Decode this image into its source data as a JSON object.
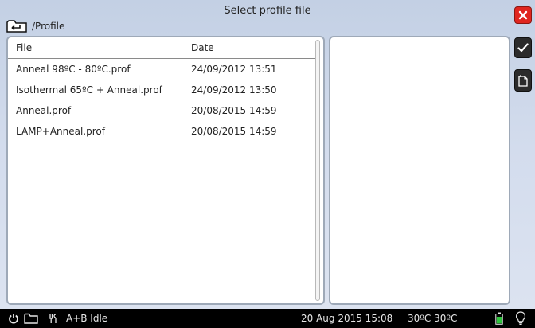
{
  "header": {
    "title": "Select profile file",
    "path": "/Profile"
  },
  "table": {
    "columns": [
      "File",
      "Date"
    ],
    "rows": [
      {
        "file": "Anneal 98ºC - 80ºC.prof",
        "date": "24/09/2012 13:51"
      },
      {
        "file": "Isothermal 65ºC + Anneal.prof",
        "date": "24/09/2012 13:50"
      },
      {
        "file": "Anneal.prof",
        "date": "20/08/2015 14:59"
      },
      {
        "file": "LAMP+Anneal.prof",
        "date": "20/08/2015 14:59"
      }
    ]
  },
  "side_buttons": {
    "close_icon": "close-icon",
    "confirm_icon": "checkmark-icon",
    "newfile_icon": "new-file-icon"
  },
  "status_bar": {
    "status": "A+B Idle",
    "datetime": "20 Aug 2015 15:08",
    "temps": "30ºC 30ºC",
    "icons": [
      "power-icon",
      "folder-icon",
      "tools-icon",
      "battery-icon",
      "bulb-icon"
    ]
  },
  "colors": {
    "close": "#e0261f",
    "battery": "#2ec43c",
    "status_bar": "#000000"
  }
}
